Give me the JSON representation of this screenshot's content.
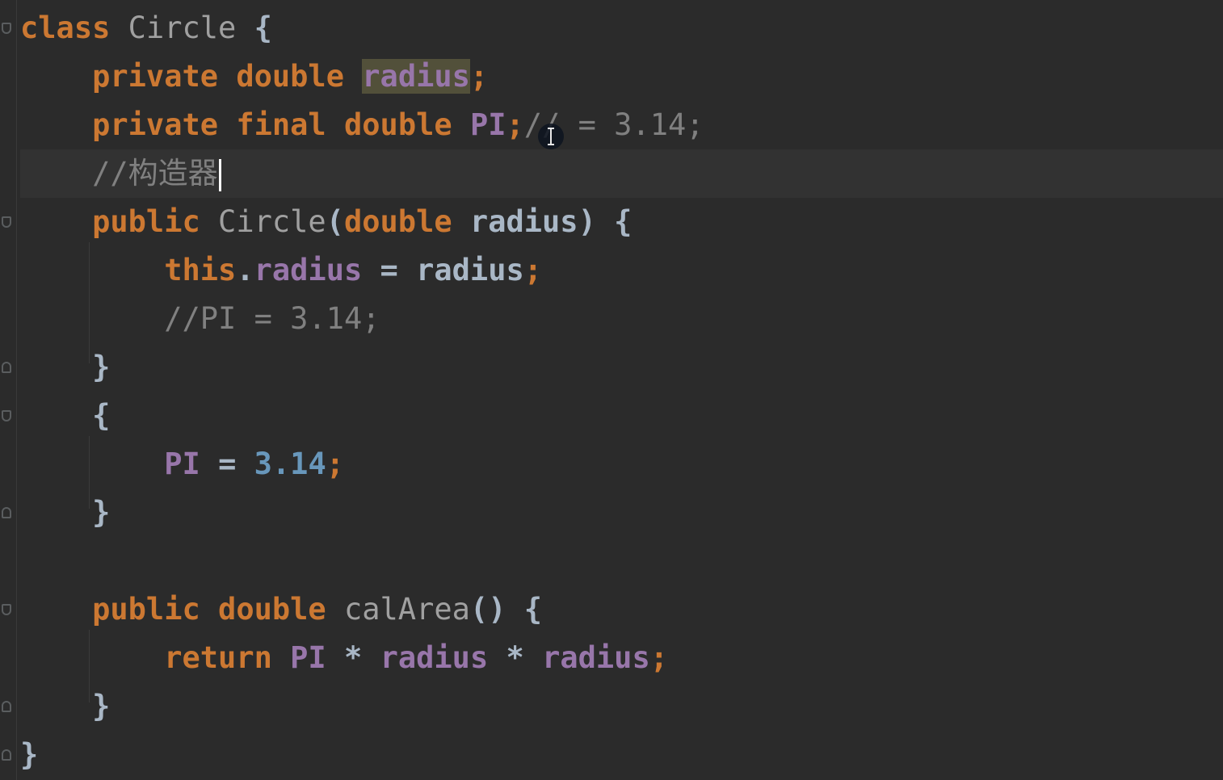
{
  "editor": {
    "language": "java",
    "lines": {
      "l1": {
        "kw": "class",
        "name": "Circle",
        "brace": "{"
      },
      "l2": {
        "kw1": "private",
        "kw2": "double",
        "field": "radius",
        "semi": ";"
      },
      "l3": {
        "kw1": "private",
        "kw2": "final",
        "kw3": "double",
        "field": "PI",
        "semi": ";",
        "comment": "// = 3.14;"
      },
      "l4": {
        "comment": "//构造器"
      },
      "l5": {
        "kw": "public",
        "name": "Circle",
        "open": "(",
        "ptype": "double",
        "pname": "radius",
        "close": ")",
        "brace": "{"
      },
      "l6": {
        "this": "this",
        "dot": ".",
        "field": "radius",
        "eq": "=",
        "value": "radius",
        "semi": ";"
      },
      "l7": {
        "comment": "//PI = 3.14;"
      },
      "l8": {
        "brace": "}"
      },
      "l9": {
        "brace": "{"
      },
      "l10": {
        "field": "PI",
        "eq": "=",
        "num": "3.14",
        "semi": ";"
      },
      "l11": {
        "brace": "}"
      },
      "l13": {
        "kw1": "public",
        "kw2": "double",
        "name": "calArea",
        "parens": "()",
        "brace": "{"
      },
      "l14": {
        "kw": "return",
        "f1": "PI",
        "op1": "*",
        "f2": "radius",
        "op2": "*",
        "f3": "radius",
        "semi": ";"
      },
      "l15": {
        "brace": "}"
      },
      "l16": {
        "brace": "}"
      }
    },
    "colors": {
      "background": "#2b2b2b",
      "keyword": "#cc7832",
      "field": "#9876aa",
      "number": "#6897bb",
      "comment": "#808080",
      "text": "#a9b7c6",
      "caret_line": "#323232",
      "usage_highlight": "#52503a"
    },
    "icons": {
      "mouse_cursor": "text-cursor-ibeam-icon",
      "fold_marker": "fold-marker-icon"
    }
  }
}
